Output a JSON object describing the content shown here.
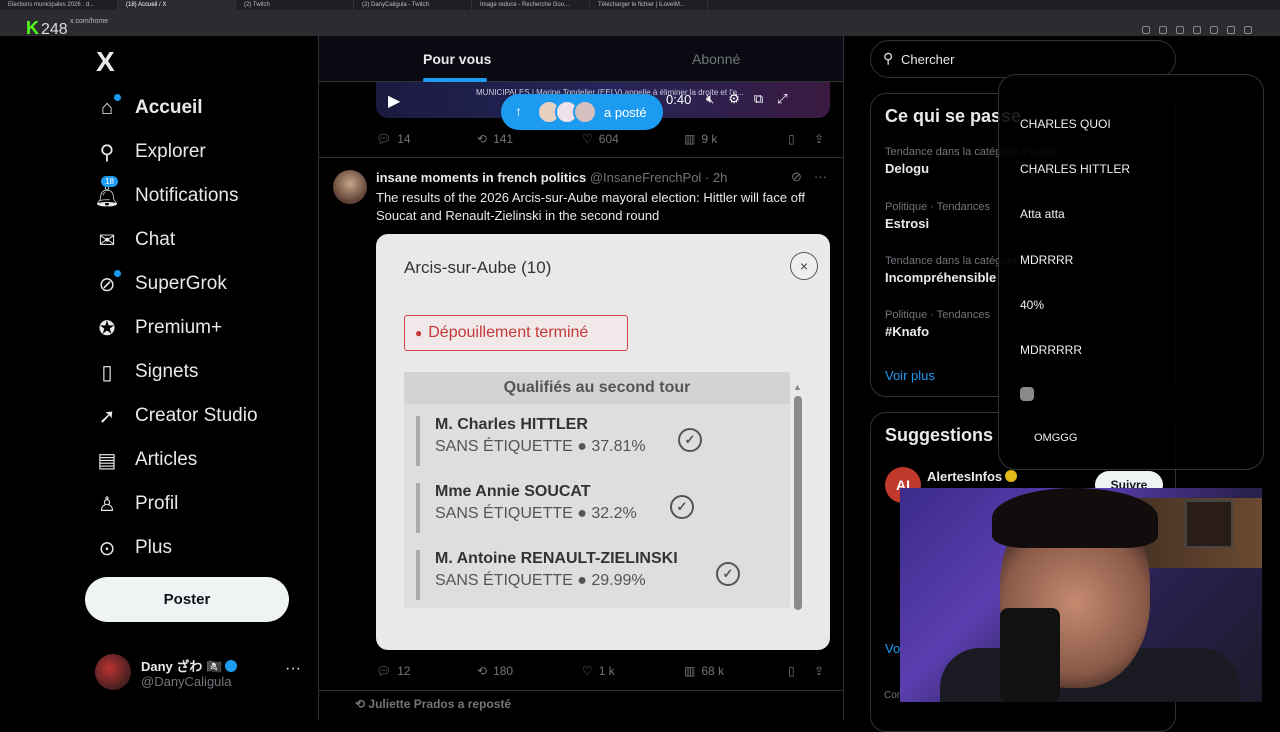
{
  "browser": {
    "tabs": [
      "Elections municipales 2026 : d...",
      "(18) Accueil / X",
      "(2) Twitch",
      "(2) DanyCaligula - Twitch",
      "Image reduce - Recherche Goo...",
      "Télécharger le fichier | iLoveIM..."
    ],
    "url": "x.com/home"
  },
  "stream": {
    "logo": "K",
    "viewers": "248"
  },
  "nav": {
    "logo": "X",
    "items": [
      {
        "label": "Accueil",
        "icon": "home-icon"
      },
      {
        "label": "Explorer",
        "icon": "search-icon"
      },
      {
        "label": "Notifications",
        "icon": "bell-icon",
        "badge": "18"
      },
      {
        "label": "Chat",
        "icon": "mail-icon"
      },
      {
        "label": "SuperGrok",
        "icon": "grok-icon"
      },
      {
        "label": "Premium+",
        "icon": "verified-icon"
      },
      {
        "label": "Signets",
        "icon": "bookmark-icon"
      },
      {
        "label": "Creator Studio",
        "icon": "rocket-icon"
      },
      {
        "label": "Articles",
        "icon": "document-icon"
      },
      {
        "label": "Profil",
        "icon": "user-icon"
      },
      {
        "label": "Plus",
        "icon": "more-circle-icon"
      }
    ],
    "post_button": "Poster"
  },
  "account": {
    "name": "Dany ざわ 🏴‍☠️",
    "handle": "@DanyCaligula",
    "more": "···"
  },
  "feed": {
    "tabs": [
      "Pour vous",
      "Abonné"
    ],
    "video": {
      "title": "MUNICIPALES | Marine Tondelier (EELV) appelle à éliminer la droite et l'e...",
      "time": "0:40"
    },
    "posted_pill": "a posté",
    "tweet1_actions": {
      "replies": "14",
      "retweets": "141",
      "likes": "604",
      "views": "9 k"
    },
    "tweet2": {
      "name": "insane moments in french politics",
      "handle": "@InsaneFrenchPol",
      "time": "· 2h",
      "text": "The results of the 2026 Arcis-sur-Aube mayoral election: Hittler will face off Soucat and Renault-Zielinski in the second round",
      "actions": {
        "replies": "12",
        "retweets": "180",
        "likes": "1 k",
        "views": "68 k"
      }
    },
    "card": {
      "title": "Arcis-sur-Aube (10)",
      "close": "×",
      "status": "Dépouillement terminé",
      "results_title": "Qualifiés au second tour",
      "candidates": [
        {
          "name": "M. Charles HITTLER",
          "sub": "SANS ÉTIQUETTE ● 37.81%",
          "percent": 37.81
        },
        {
          "name": "Mme Annie SOUCAT",
          "sub": "SANS ÉTIQUETTE ● 32.2%",
          "percent": 32.2
        },
        {
          "name": "M. Antoine RENAULT-ZIELINSKI",
          "sub": "SANS ÉTIQUETTE ● 29.99%",
          "percent": 29.99
        }
      ]
    },
    "retweet_line": "Juliette Prados a reposté"
  },
  "right": {
    "search_placeholder": "Chercher",
    "trends_title": "Ce qui se passe",
    "trends": [
      {
        "meta": "Tendance dans la catégorie France",
        "name": "Delogu"
      },
      {
        "meta": "Politique · Tendances",
        "name": "Estrosi"
      },
      {
        "meta": "Tendance dans la catégorie France",
        "name": "Incompréhensible"
      },
      {
        "meta": "Politique · Tendances",
        "name": "#Knafo"
      }
    ],
    "trends_more": "Voir plus",
    "suggestions_title": "Suggestions",
    "suggestion": {
      "name": "AlertesInfos",
      "avatar": "AI",
      "follow": "Suivre"
    },
    "suggestions_more": "Voir plus",
    "footer": "Conditions"
  },
  "chat": {
    "messages": [
      "CHARLES QUOI",
      "CHARLES HITTLER",
      "Atta atta",
      "MDRRRR",
      "40%",
      "MDRRRRR",
      "OMGGG"
    ]
  }
}
